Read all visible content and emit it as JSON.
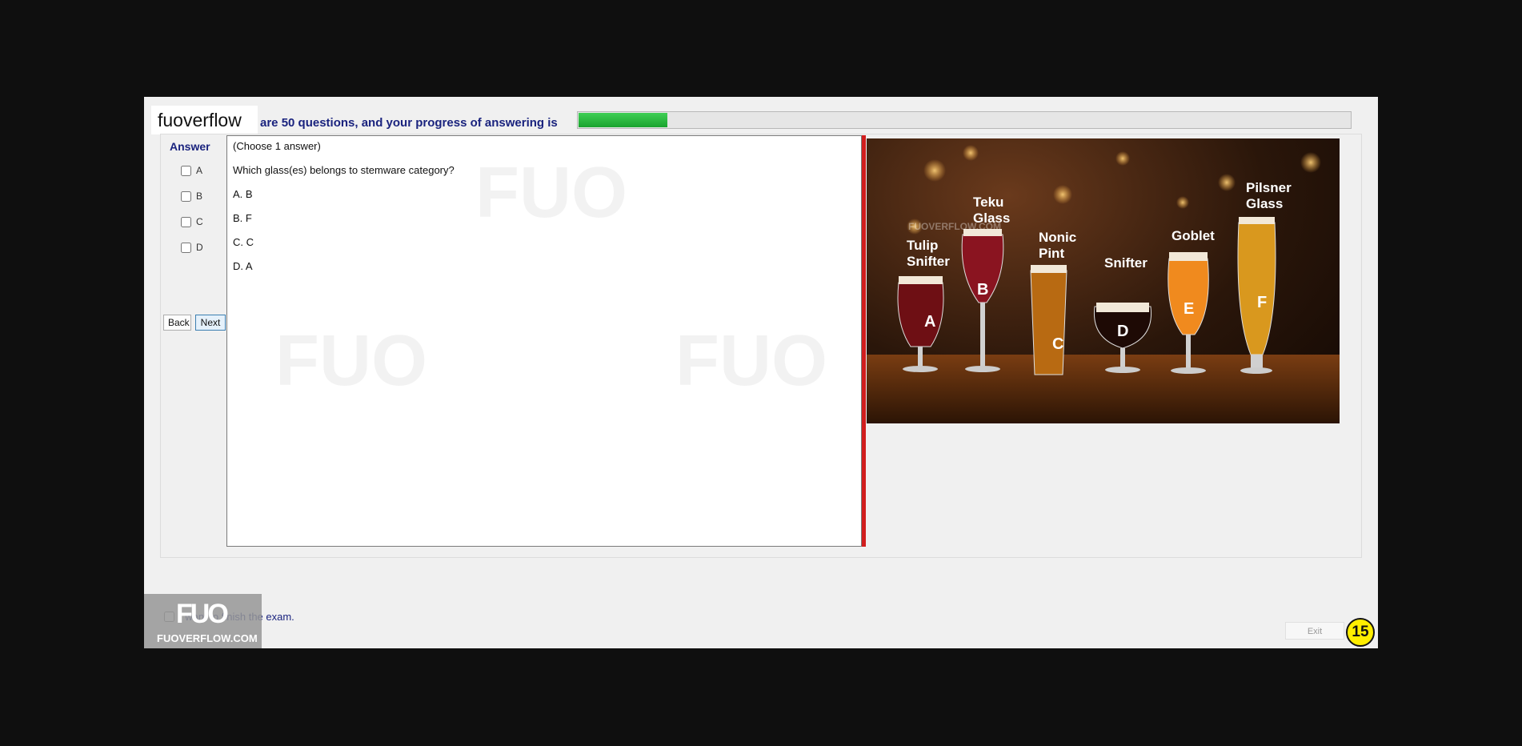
{
  "brand": {
    "name": "fuoverflow"
  },
  "progress": {
    "text": "are 50 questions, and your progress of answering is",
    "fraction": 0.115
  },
  "answer_panel": {
    "title": "Answer",
    "options": [
      "A",
      "B",
      "C",
      "D"
    ],
    "back_label": "Back",
    "next_label": "Next"
  },
  "question": {
    "instruction": "(Choose 1 answer)",
    "text": "Which glass(es) belongs to stemware category?",
    "choices": [
      "A.  B",
      "B.  F",
      "C.  C",
      "D.  A"
    ]
  },
  "image": {
    "labels": [
      {
        "id": "tulip",
        "name": "Tulip Snifter",
        "letter": "A"
      },
      {
        "id": "teku",
        "name": "Teku Glass",
        "letter": "B"
      },
      {
        "id": "nonic",
        "name": "Nonic Pint",
        "letter": "C"
      },
      {
        "id": "snifter",
        "name": "Snifter",
        "letter": "D"
      },
      {
        "id": "goblet",
        "name": "Goblet",
        "letter": "E"
      },
      {
        "id": "pilsner",
        "name": "Pilsner Glass",
        "letter": "F"
      }
    ],
    "watermark": "FUOVERFLOW.COM"
  },
  "footer": {
    "finish_label": "I want to finish the exam.",
    "exit_label": "Exit",
    "logo_big": "FUO",
    "logo_small": "FUOVERFLOW.COM",
    "page_number": "15"
  },
  "colors": {
    "accent": "#1a237e",
    "divider": "#d11e1e",
    "progress": "#22b33a",
    "badge": "#ffee00"
  }
}
